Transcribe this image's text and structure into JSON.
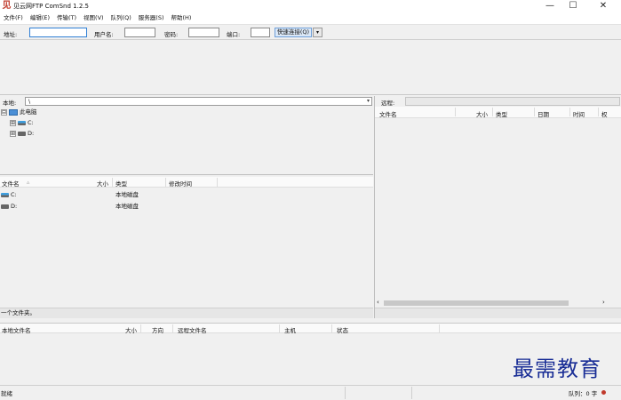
{
  "window": {
    "title": "见云网FTP ComSnd 1.2.5",
    "logo_char": "见",
    "minimize": "—",
    "maximize": "☐",
    "close": "✕"
  },
  "menu": [
    "文件(F)",
    "编辑(E)",
    "传输(T)",
    "视图(V)",
    "队列(Q)",
    "服务器(S)",
    "帮助(H)"
  ],
  "quickconnect": {
    "host_label": "地址:",
    "user_label": "用户名:",
    "pass_label": "密码:",
    "port_label": "端口:",
    "host_value": "",
    "user_value": "",
    "pass_value": "",
    "port_value": "",
    "button_label": "快速连接(Q)",
    "dropdown": "▾"
  },
  "local": {
    "path_label": "本地:",
    "path_value": "\\",
    "dropdown": "▾",
    "tree": [
      {
        "label": "此电脑",
        "expander": "⊟",
        "icon": "computer-icon"
      },
      {
        "label": "C:",
        "expander": "⊞",
        "icon": "system-drive-icon"
      },
      {
        "label": "D:",
        "expander": "⊞",
        "icon": "drive-icon"
      }
    ],
    "columns": {
      "name": "文件名",
      "sort": "▵",
      "size": "大小",
      "type": "类型",
      "modified": "修改时间"
    },
    "files": [
      {
        "name": "C:",
        "size": "",
        "type": "本地磁盘",
        "modified": "",
        "icon": "system-drive-icon"
      },
      {
        "name": "D:",
        "size": "",
        "type": "本地磁盘",
        "modified": "",
        "icon": "drive-icon"
      }
    ],
    "status": "一个文件夹。"
  },
  "remote": {
    "path_label": "远程:",
    "path_value": "",
    "columns": {
      "name": "文件名",
      "size": "大小",
      "type": "类型",
      "date": "日期",
      "time": "时间",
      "perm": "权"
    },
    "scroll_left": "‹",
    "scroll_right": "›"
  },
  "queue": {
    "columns": {
      "local_file": "本地文件名",
      "size": "大小",
      "direction": "方向",
      "remote_file": "远程文件名",
      "host": "主机",
      "status": "状态"
    }
  },
  "statusbar": {
    "ready": "就绪",
    "queue": "队列：0 字"
  },
  "watermark": "最需教育",
  "colors": {
    "accent": "#2f7fd5",
    "watermark": "#1a2e96",
    "status_dot": "#c0392b"
  }
}
